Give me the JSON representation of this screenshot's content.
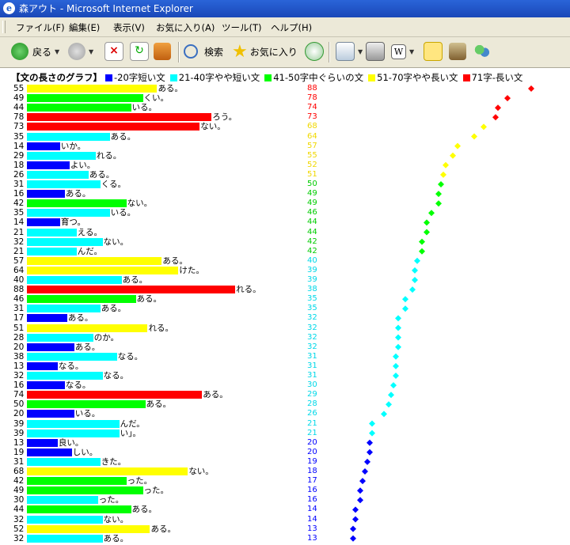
{
  "window": {
    "title": "森アウト - Microsoft Internet Explorer"
  },
  "menu": [
    "ファイル(F)",
    "編集(E)",
    "表示(V)",
    "お気に入り(A)",
    "ツール(T)",
    "ヘルプ(H)"
  ],
  "toolbar": {
    "back_label": "戻る",
    "search_label": "検索",
    "favorites_label": "お気に入り"
  },
  "legend": {
    "title": "【文の長さのグラフ】",
    "items": [
      {
        "label": "-20字短い文",
        "color": "#0000ff"
      },
      {
        "label": "21-40字やや短い文",
        "color": "#00ffff"
      },
      {
        "label": "41-50字中ぐらいの文",
        "color": "#00ff00"
      },
      {
        "label": "51-70字やや長い文",
        "color": "#ffff00"
      },
      {
        "label": "71字-長い文",
        "color": "#ff0000"
      }
    ]
  },
  "chart_data": {
    "type": "bar",
    "rows": [
      {
        "length": 55,
        "ending": "ある。"
      },
      {
        "length": 49,
        "ending": "くい。"
      },
      {
        "length": 44,
        "ending": "いる。"
      },
      {
        "length": 78,
        "ending": "ろう。"
      },
      {
        "length": 73,
        "ending": "ない。"
      },
      {
        "length": 35,
        "ending": "ある。"
      },
      {
        "length": 14,
        "ending": "いか。"
      },
      {
        "length": 29,
        "ending": "れる。"
      },
      {
        "length": 18,
        "ending": "よい。"
      },
      {
        "length": 26,
        "ending": "ある。"
      },
      {
        "length": 31,
        "ending": "くる。"
      },
      {
        "length": 16,
        "ending": "ある。"
      },
      {
        "length": 42,
        "ending": "ない。"
      },
      {
        "length": 35,
        "ending": "いる。"
      },
      {
        "length": 14,
        "ending": "育つ。"
      },
      {
        "length": 21,
        "ending": "える。"
      },
      {
        "length": 32,
        "ending": "ない。"
      },
      {
        "length": 21,
        "ending": "んだ。"
      },
      {
        "length": 57,
        "ending": "ある。"
      },
      {
        "length": 64,
        "ending": "けた。"
      },
      {
        "length": 40,
        "ending": "ある。"
      },
      {
        "length": 88,
        "ending": "れる。"
      },
      {
        "length": 46,
        "ending": "ある。"
      },
      {
        "length": 31,
        "ending": "ある。"
      },
      {
        "length": 17,
        "ending": "ある。"
      },
      {
        "length": 51,
        "ending": "れる。"
      },
      {
        "length": 28,
        "ending": "のか。"
      },
      {
        "length": 20,
        "ending": "ある。"
      },
      {
        "length": 38,
        "ending": "なる。"
      },
      {
        "length": 13,
        "ending": "なる。"
      },
      {
        "length": 32,
        "ending": "なる。"
      },
      {
        "length": 16,
        "ending": "なる。"
      },
      {
        "length": 74,
        "ending": "ある。"
      },
      {
        "length": 50,
        "ending": "ある。"
      },
      {
        "length": 20,
        "ending": "いる。"
      },
      {
        "length": 39,
        "ending": "んだ。"
      },
      {
        "length": 39,
        "ending": "い」。"
      },
      {
        "length": 13,
        "ending": "良い。"
      },
      {
        "length": 19,
        "ending": "しい。"
      },
      {
        "length": 31,
        "ending": "きた。"
      },
      {
        "length": 68,
        "ending": "ない。"
      },
      {
        "length": 42,
        "ending": "った。"
      },
      {
        "length": 49,
        "ending": "った。"
      },
      {
        "length": 30,
        "ending": "った。"
      },
      {
        "length": 44,
        "ending": "ある。"
      },
      {
        "length": 32,
        "ending": "ない。"
      },
      {
        "length": 52,
        "ending": "ある。"
      },
      {
        "length": 32,
        "ending": "ある。"
      }
    ],
    "sorted_lengths": [
      88,
      78,
      74,
      73,
      68,
      64,
      57,
      55,
      52,
      51,
      50,
      49,
      49,
      46,
      44,
      44,
      42,
      42,
      40,
      39,
      39,
      38,
      35,
      35,
      32,
      32,
      32,
      32,
      31,
      31,
      31,
      30,
      29,
      28,
      26,
      21,
      21,
      20,
      20,
      19,
      18,
      17,
      16,
      16,
      14,
      14,
      13,
      13
    ]
  }
}
